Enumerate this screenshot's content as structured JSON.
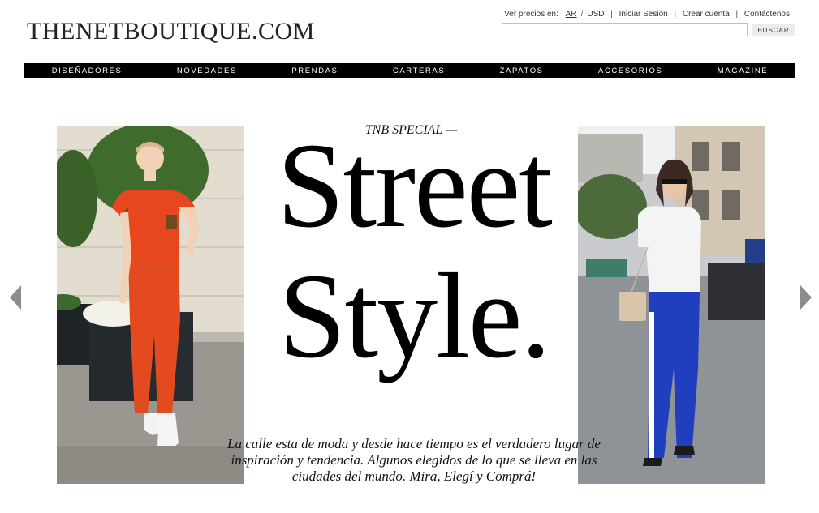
{
  "header": {
    "logo": "THENETBOUTIQUE.COM",
    "prices_label": "Ver precios en:",
    "currency_ar": "AR",
    "currency_usd": "USD",
    "login": "Iniciar Sesión",
    "register": "Crear cuenta",
    "contact": "Contáctenos",
    "search_placeholder": "",
    "search_button": "BUSCAR"
  },
  "nav": {
    "items": [
      "DISEÑADORES",
      "NOVEDADES",
      "PRENDAS",
      "CARTERAS",
      "ZAPATOS",
      "ACCESORIOS",
      "MAGAZINE"
    ]
  },
  "hero": {
    "kicker": "TNB SPECIAL —",
    "headline_line1": "Street",
    "headline_line2": "Style.",
    "description": "La calle esta de moda y desde hace tiempo es el verdadero lugar de inspiración y tendencia. Algunos elegidos de lo que se lleva en las ciudades del mundo. Mira, Elegí y Comprá!"
  },
  "colors": {
    "navbar": "#000000",
    "left_outfit": "#e8461e",
    "right_pants": "#1f3fbf",
    "arrow": "#8c8c8c"
  }
}
